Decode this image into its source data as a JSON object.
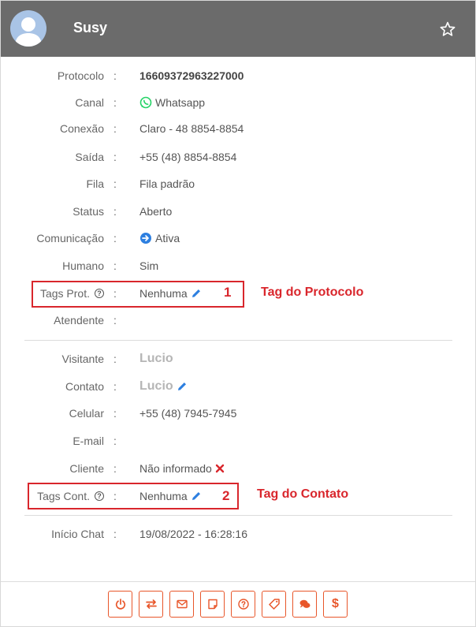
{
  "header": {
    "name": "Susy"
  },
  "fields": {
    "protocolo": {
      "label": "Protocolo",
      "value": "16609372963227000"
    },
    "canal": {
      "label": "Canal",
      "value": "Whatsapp"
    },
    "conexao": {
      "label": "Conexão",
      "value": "Claro - 48 8854-8854"
    },
    "saida": {
      "label": "Saída",
      "value": "+55 (48) 8854-8854"
    },
    "fila": {
      "label": "Fila",
      "value": "Fila padrão"
    },
    "status": {
      "label": "Status",
      "value": "Aberto"
    },
    "comunicacao": {
      "label": "Comunicação",
      "value": "Ativa"
    },
    "humano": {
      "label": "Humano",
      "value": "Sim"
    },
    "tags_prot": {
      "label": "Tags Prot.",
      "value": "Nenhuma"
    },
    "atendente": {
      "label": "Atendente",
      "value": ""
    },
    "visitante": {
      "label": "Visitante",
      "value": "Lucio"
    },
    "contato": {
      "label": "Contato",
      "value": "Lucio"
    },
    "celular": {
      "label": "Celular",
      "value": "+55 (48) 7945-7945"
    },
    "email": {
      "label": "E-mail",
      "value": ""
    },
    "cliente": {
      "label": "Cliente",
      "value": "Não informado"
    },
    "tags_cont": {
      "label": "Tags Cont.",
      "value": "Nenhuma"
    },
    "inicio_chat": {
      "label": "Início Chat",
      "value": "19/08/2022 - 16:28:16"
    }
  },
  "separator": ":",
  "help_glyph": "?",
  "annotations": {
    "one": {
      "num": "1",
      "text": "Tag do Protocolo"
    },
    "two": {
      "num": "2",
      "text": "Tag do Contato"
    }
  },
  "toolbar": {
    "icons": [
      "power-icon",
      "transfer-icon",
      "envelope-icon",
      "note-icon",
      "question-icon",
      "tag-icon",
      "chat-icon",
      "dollar-icon"
    ],
    "dollar_glyph": "$"
  },
  "colors": {
    "header": "#6b6b6b",
    "accent": "#e8562a",
    "annotation": "#d9262c",
    "edit": "#2d7fe0",
    "whatsapp": "#25d366"
  }
}
